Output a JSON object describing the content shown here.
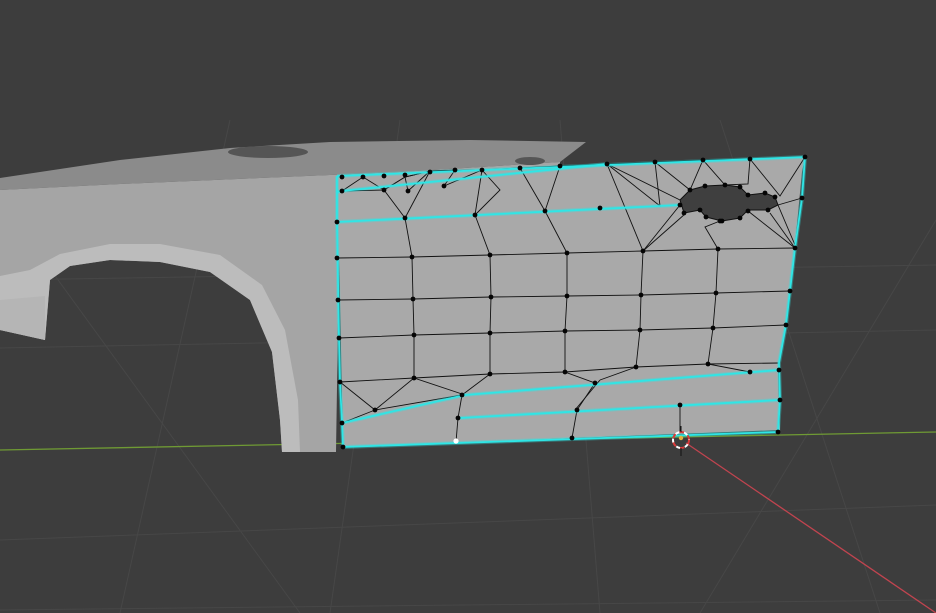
{
  "viewport": {
    "mode": "edit-mode",
    "colors": {
      "background": "#3d3d3d",
      "grid_line": "#474747",
      "x_axis": "#c0444f",
      "y_axis": "#6f9a34",
      "mesh_fill": "#a9a9a9",
      "body_fill": "#9a9a9a",
      "edge": "#111111",
      "selected_edge": "#2ee6e6",
      "vertex": "#050505",
      "active_vertex": "#ffffff",
      "cursor_ring_red": "#d93a3a",
      "cursor_ring_white": "#ffffff"
    },
    "icons": [
      "3d-cursor-icon"
    ]
  }
}
